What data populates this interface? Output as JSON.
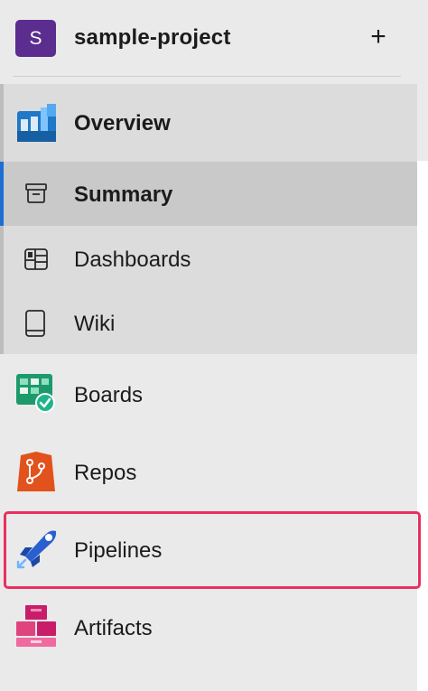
{
  "project": {
    "avatar_letter": "S",
    "name": "sample-project",
    "add_symbol": "+"
  },
  "nav": {
    "overview": {
      "label": "Overview",
      "icon": "overview-icon"
    },
    "summary": {
      "label": "Summary",
      "icon": "summary-icon",
      "selected": true
    },
    "dashboards": {
      "label": "Dashboards",
      "icon": "dashboards-icon"
    },
    "wiki": {
      "label": "Wiki",
      "icon": "wiki-icon"
    },
    "boards": {
      "label": "Boards",
      "icon": "boards-icon"
    },
    "repos": {
      "label": "Repos",
      "icon": "repos-icon"
    },
    "pipelines": {
      "label": "Pipelines",
      "icon": "pipelines-icon",
      "highlighted": true
    },
    "artifacts": {
      "label": "Artifacts",
      "icon": "artifacts-icon"
    }
  },
  "colors": {
    "avatar": "#5b2d8e",
    "selection_bar": "#1e6fd1",
    "highlight_box": "#e8305f",
    "sidebar_bg": "#eaeaea"
  }
}
